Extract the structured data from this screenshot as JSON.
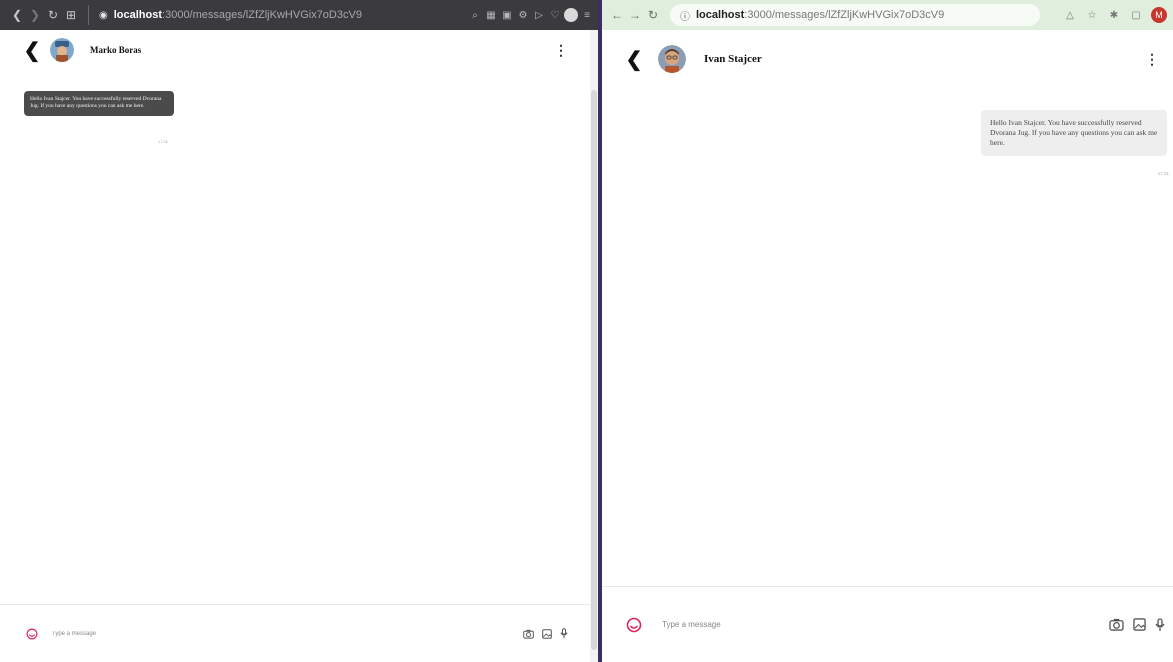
{
  "left_window": {
    "url_host": "localhost",
    "url_path": ":3000/messages/lZfZljKwHVGix7oD3cV9",
    "contact_name": "Marko Boras",
    "message_text": "Hello Ivan Stajcer. You have successfully reserved Dvorana Jug. If you have any questions you can ask me here.",
    "message_time": "17:31",
    "input_placeholder": "Type a message"
  },
  "right_window": {
    "url_host": "localhost",
    "url_path": ":3000/messages/lZfZljKwHVGix7oD3cV9",
    "contact_name": "Ivan Stajcer",
    "message_text": "Hello Ivan Stajcer. You have successfully reserved Dvorana Jug. If you have any questions you can ask me here.",
    "message_time": "17:31",
    "input_placeholder": "Type a message",
    "profile_initial": "M"
  },
  "colors": {
    "emoji_accent": "#e0245e",
    "left_bubble": "#4b4b4b",
    "right_bubble": "#eeeeee",
    "split_divider": "#3a2f5e"
  },
  "icons": {
    "back": "chevron-left-icon",
    "more": "more-vertical-icon",
    "emoji": "emoji-icon",
    "camera": "camera-icon",
    "image": "image-icon",
    "mic": "microphone-icon"
  }
}
